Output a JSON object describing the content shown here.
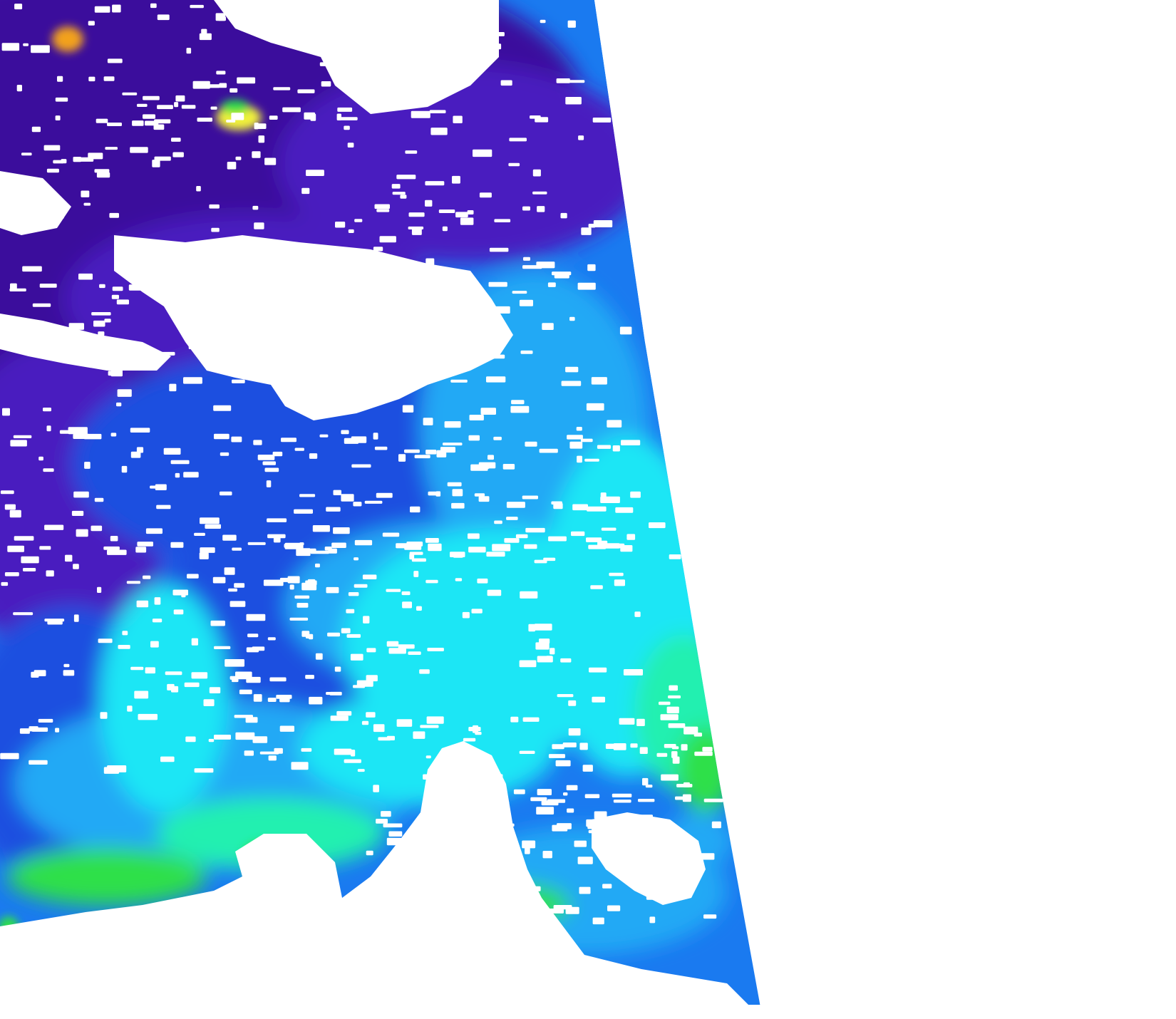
{
  "image": {
    "kind": "satellite ocean color swath",
    "description_visible_text": []
  },
  "colors": {
    "background": "#ffffff",
    "cloud_mask": "#ffffff",
    "deep_purple": "#3a0f9c",
    "indigo": "#4a1bbf",
    "royal_blue": "#1f4fe0",
    "blue": "#1a7af0",
    "sky_blue": "#22a9f5",
    "cyan": "#1ee6f5",
    "aqua_green": "#22f0b0",
    "green": "#2fe04a",
    "dark_green": "#1e8f2c",
    "yellow_green": "#c8f03a",
    "yellow": "#f2f23a",
    "orange": "#f2a11c"
  },
  "legend": {
    "visible": false
  }
}
